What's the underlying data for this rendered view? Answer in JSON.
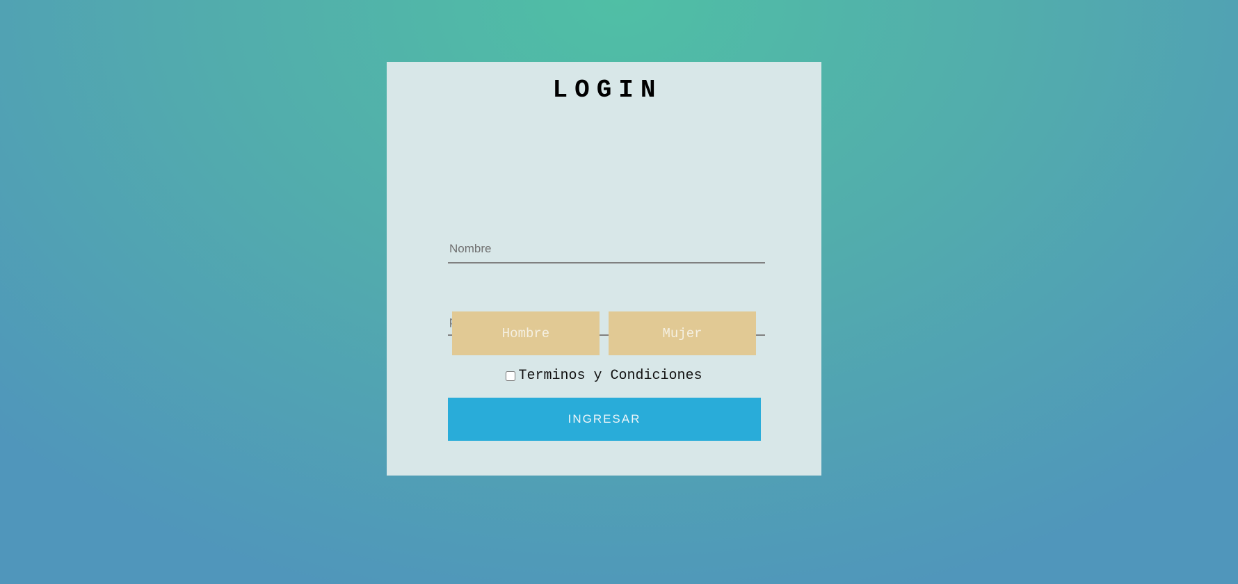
{
  "login_card": {
    "title": "LOGIN",
    "name_field": {
      "placeholder": "Nombre",
      "value": ""
    },
    "email_field": {
      "placeholder": "preueba@correo.com",
      "value": ""
    },
    "gender": {
      "male_label": "Hombre",
      "female_label": "Mujer"
    },
    "terms": {
      "label": "Terminos y Condiciones",
      "checked": false
    },
    "submit_label": "INGRESAR"
  },
  "colors": {
    "card_background": "#d8e7e8",
    "gender_button": "#e1c994",
    "submit_button": "#29acd9",
    "background_top": "#50bfa5",
    "background_bottom": "#5096bb"
  }
}
